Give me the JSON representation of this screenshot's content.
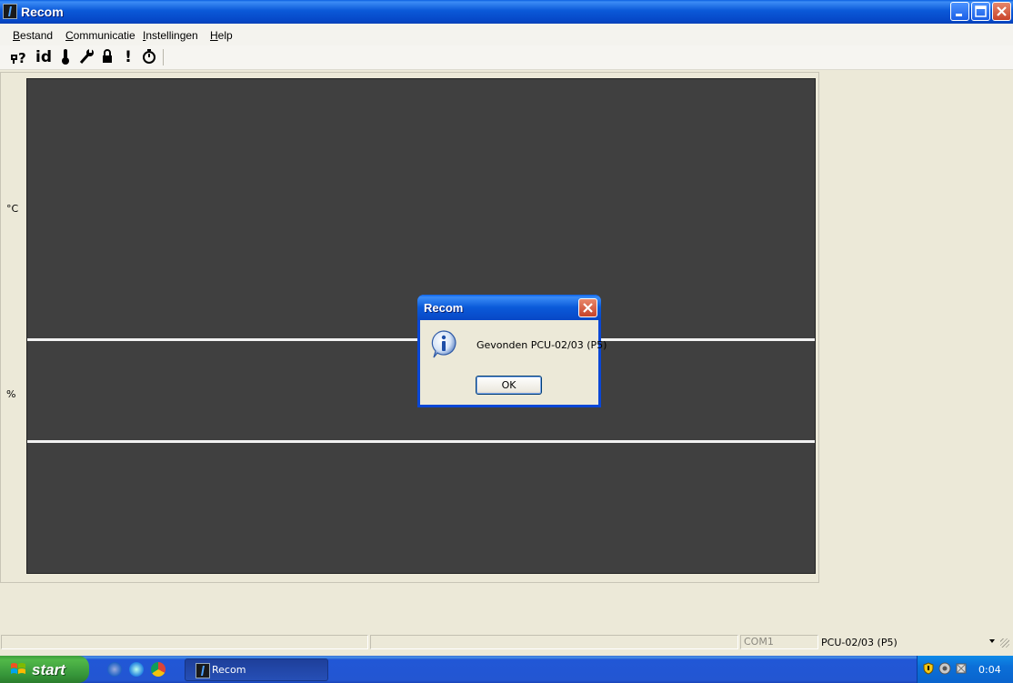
{
  "window": {
    "title": "Recom",
    "icon": "recom-app-icon"
  },
  "menu": {
    "items": [
      "Bestand",
      "Communicatie",
      "Instellingen",
      "Help"
    ]
  },
  "toolbar": {
    "buttons": [
      {
        "label": "Ч?",
        "icon": "connect-query-icon"
      },
      {
        "label": "id",
        "icon": "id-icon"
      },
      {
        "label": "🌡",
        "icon": "thermometer-icon"
      },
      {
        "label": "🔧",
        "icon": "wrench-icon"
      },
      {
        "label": "🔒",
        "icon": "lock-icon"
      },
      {
        "label": "!",
        "icon": "alarm-icon"
      },
      {
        "label": "⏱",
        "icon": "stopwatch-icon"
      }
    ]
  },
  "chart": {
    "units": [
      "°C",
      "%"
    ]
  },
  "status": {
    "port": "COM1",
    "device": "PCU-02/03 (P5)"
  },
  "dialog": {
    "title": "Recom",
    "message": "Gevonden PCU-02/03 (P5)",
    "ok_label": "OK",
    "icon": "information-icon"
  },
  "taskbar": {
    "start_label": "start",
    "task_label": "Recom",
    "clock": "0:04"
  }
}
